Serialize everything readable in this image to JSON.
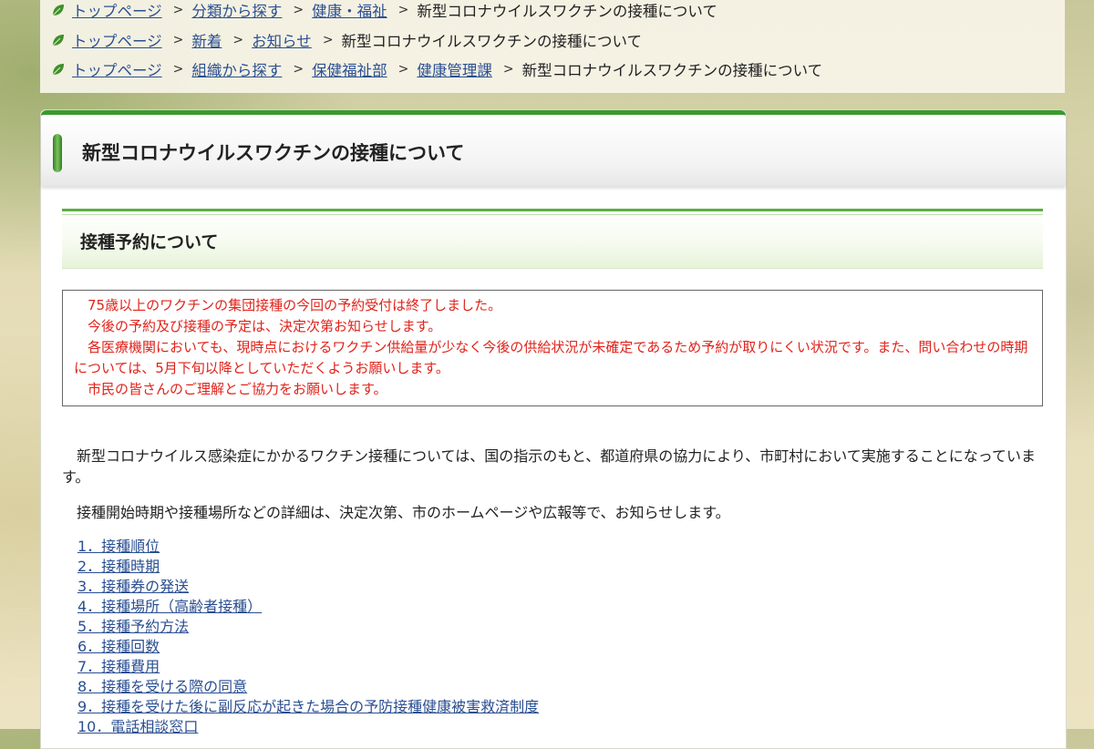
{
  "breadcrumbs": [
    {
      "links": [
        "トップページ",
        "分類から探す",
        "健康・福祉"
      ],
      "current": "新型コロナウイルスワクチンの接種について"
    },
    {
      "links": [
        "トップページ",
        "新着",
        "お知らせ"
      ],
      "current": "新型コロナウイルスワクチンの接種について"
    },
    {
      "links": [
        "トップページ",
        "組織から探す",
        "保健福祉部",
        "健康管理課"
      ],
      "current": "新型コロナウイルスワクチンの接種について"
    }
  ],
  "page_title": "新型コロナウイルスワクチンの接種について",
  "section_title": "接種予約について",
  "notice": [
    "　75歳以上のワクチンの集団接種の今回の予約受付は終了しました。",
    "　今後の予約及び接種の予定は、決定次第お知らせします。",
    "　各医療機関においても、現時点におけるワクチン供給量が少なく今後の供給状況が未確定であるため予約が取りにくい状況です。また、問い合わせの時期については、5月下旬以降としていただくようお願いします。",
    "　市民の皆さんのご理解とご協力をお願いします。"
  ],
  "body": [
    "　新型コロナウイルス感染症にかかるワクチン接種については、国の指示のもと、都道府県の協力により、市町村において実施することになっています。",
    "　接種開始時期や接種場所などの詳細は、決定次第、市のホームページや広報等で、お知らせします。"
  ],
  "toc": [
    "1．接種順位",
    "2．接種時期",
    "3．接種券の発送",
    "4．接種場所（高齢者接種）",
    "5．接種予約方法",
    "6．接種回数",
    "7．接種費用",
    "8．接種を受ける際の同意",
    "9．接種を受けた後に副反応が起きた場合の予防接種健康被害救済制度",
    "10．電話相談窓口"
  ],
  "colors": {
    "accent_green": "#3a9a2f",
    "link": "#2b4f92",
    "notice_red": "#e0231b"
  }
}
